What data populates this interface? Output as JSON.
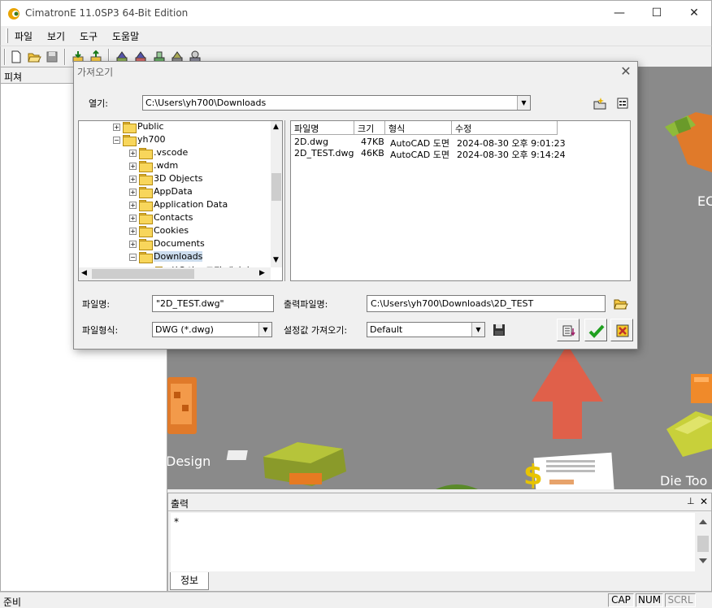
{
  "window": {
    "title": "CimatronE 11.0SP3 64-Bit Edition",
    "min": "—",
    "max": "☐",
    "close": "✕"
  },
  "menu": [
    "파일",
    "보기",
    "도구",
    "도움말"
  ],
  "feature_pane": {
    "title": "피쳐"
  },
  "canvas": {
    "labels": {
      "design": "Design",
      "ec": "EC",
      "die_tools": "Die Too"
    }
  },
  "output": {
    "title": "출력",
    "pin": "📌",
    "close": "✕",
    "text": "*",
    "tab": "정보"
  },
  "status": {
    "ready": "준비",
    "cap": "CAP",
    "num": "NUM",
    "scrl": "SCRL"
  },
  "dialog": {
    "title": "가져오기",
    "open_label": "열기:",
    "open_path": "C:\\Users\\yh700\\Downloads",
    "tree": [
      {
        "label": "Public",
        "level": 1,
        "expander": "+"
      },
      {
        "label": "yh700",
        "level": 1,
        "expander": "−"
      },
      {
        "label": ".vscode",
        "level": 2,
        "expander": "+"
      },
      {
        "label": ".wdm",
        "level": 2,
        "expander": "+"
      },
      {
        "label": "3D Objects",
        "level": 2,
        "expander": "+"
      },
      {
        "label": "AppData",
        "level": 2,
        "expander": "+"
      },
      {
        "label": "Application Data",
        "level": 2,
        "expander": "+"
      },
      {
        "label": "Contacts",
        "level": 2,
        "expander": "+"
      },
      {
        "label": "Cookies",
        "level": 2,
        "expander": "+"
      },
      {
        "label": "Documents",
        "level": 2,
        "expander": "+"
      },
      {
        "label": "Downloads",
        "level": 2,
        "expander": "−",
        "selected": true
      },
      {
        "label": "최우의 프로필 패키지",
        "level": 3,
        "expander": "+"
      }
    ],
    "columns": [
      "파일명",
      "크기",
      "형식",
      "수정"
    ],
    "files": [
      {
        "name": "2D.dwg",
        "size": "47KB",
        "type": "AutoCAD 도면",
        "modified": "2024-08-30 오후 9:01:23"
      },
      {
        "name": "2D_TEST.dwg",
        "size": "46KB",
        "type": "AutoCAD 도면",
        "modified": "2024-08-30 오후 9:14:24"
      }
    ],
    "filename_label": "파일명:",
    "filename_value": "\"2D_TEST.dwg\"",
    "output_filename_label": "출력파일명:",
    "output_filename_value": "C:\\Users\\yh700\\Downloads\\2D_TEST",
    "filetype_label": "파일형식:",
    "filetype_value": "DWG (*.dwg)",
    "settings_label": "설정값 가져오기:",
    "settings_value": "Default"
  },
  "annotation": {
    "arrow_color": "#e0604a"
  }
}
